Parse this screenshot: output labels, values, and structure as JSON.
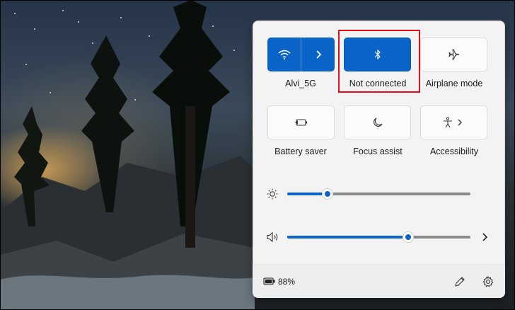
{
  "quick_settings": {
    "tiles": [
      {
        "label": "Alvi_5G",
        "icon": "wifi-icon",
        "state": "on"
      },
      {
        "label": "Not connected",
        "icon": "bluetooth-icon",
        "state": "on"
      },
      {
        "label": "Airplane mode",
        "icon": "airplane-icon",
        "state": "off"
      },
      {
        "label": "Battery saver",
        "icon": "battery-saver-icon",
        "state": "off"
      },
      {
        "label": "Focus assist",
        "icon": "moon-icon",
        "state": "off"
      },
      {
        "label": "Accessibility",
        "icon": "accessibility-icon",
        "state": "off"
      }
    ],
    "brightness": {
      "icon": "brightness-icon",
      "value": 0.22
    },
    "volume": {
      "icon": "speaker-icon",
      "value": 0.66
    },
    "battery": {
      "icon": "battery-icon",
      "percent": "88%"
    },
    "footer_icons": [
      "edit-pencil-icon",
      "settings-gear-icon"
    ]
  },
  "colors": {
    "accent": "#0a64c8",
    "highlight": "#e3101b",
    "panel": "#f3f3f3"
  }
}
